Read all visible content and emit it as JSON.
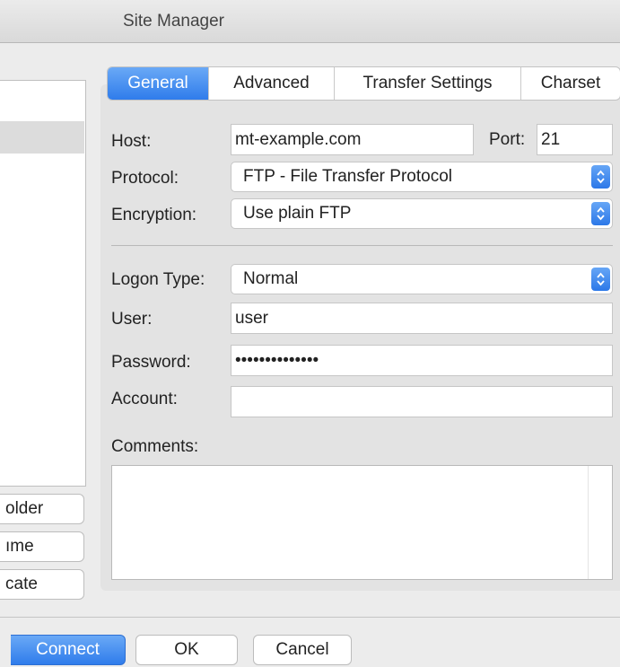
{
  "window": {
    "title": "Site Manager"
  },
  "site_list_buttons": {
    "new_folder": "older",
    "rename": "ıme",
    "duplicate": "cate"
  },
  "tabs": [
    {
      "label": "General",
      "active": true
    },
    {
      "label": "Advanced",
      "active": false
    },
    {
      "label": "Transfer Settings",
      "active": false
    },
    {
      "label": "Charset",
      "active": false
    }
  ],
  "general": {
    "host_label": "Host:",
    "host_value": "mt-example.com",
    "port_label": "Port:",
    "port_value": "21",
    "protocol_label": "Protocol:",
    "protocol_value": "FTP - File Transfer Protocol",
    "encryption_label": "Encryption:",
    "encryption_value": "Use plain FTP",
    "logon_type_label": "Logon Type:",
    "logon_type_value": "Normal",
    "user_label": "User:",
    "user_value": "user",
    "password_label": "Password:",
    "password_value": "••••••••••••••",
    "account_label": "Account:",
    "account_value": "",
    "comments_label": "Comments:",
    "comments_value": ""
  },
  "footer": {
    "connect": "Connect",
    "ok": "OK",
    "cancel": "Cancel"
  },
  "colors": {
    "accent": "#2f7ceb",
    "window_bg": "#ececec",
    "panel_bg": "#e3e3e3"
  },
  "icons": {
    "select_arrows": "updown-chevron-icon"
  }
}
